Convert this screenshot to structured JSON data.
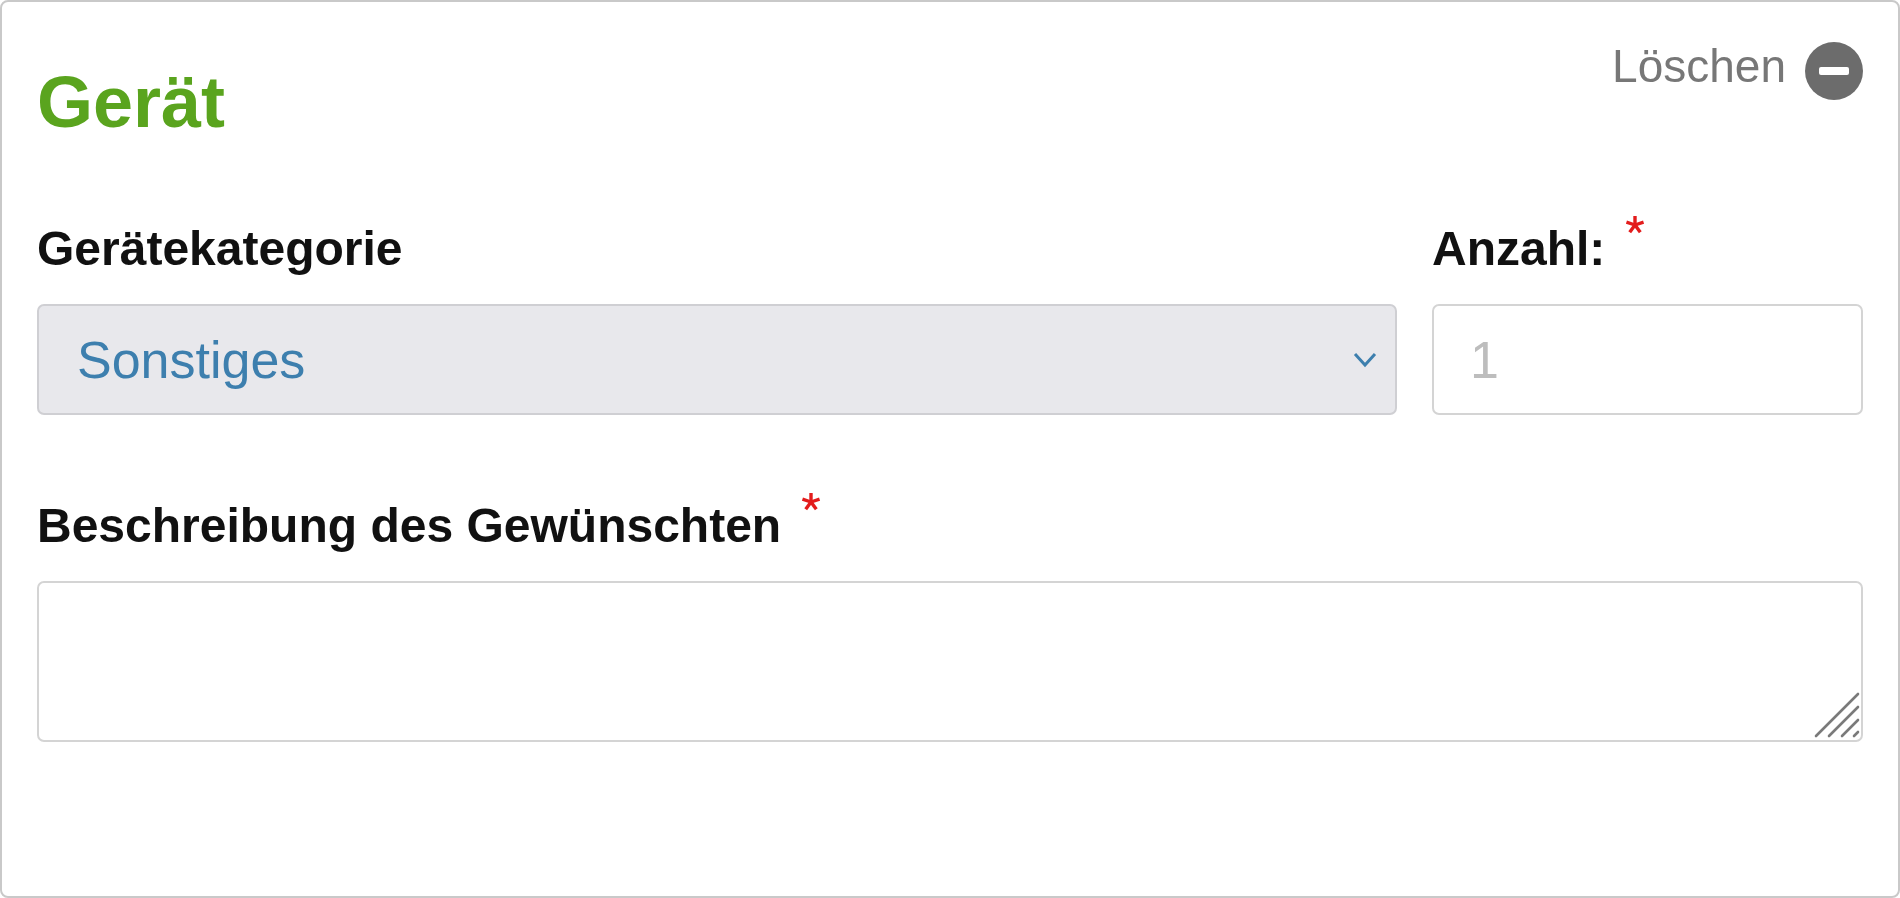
{
  "card": {
    "title": "Gerät",
    "delete_button": {
      "label": "Löschen"
    }
  },
  "fields": [
    {
      "kind": "select",
      "label": "Gerätekategorie",
      "required": false,
      "value": "Sonstiges"
    },
    {
      "kind": "number",
      "label": "Anzahl:",
      "required": true,
      "placeholder": "1"
    },
    {
      "kind": "textarea",
      "label": "Beschreibung des Gewünschten",
      "required": true
    }
  ]
}
